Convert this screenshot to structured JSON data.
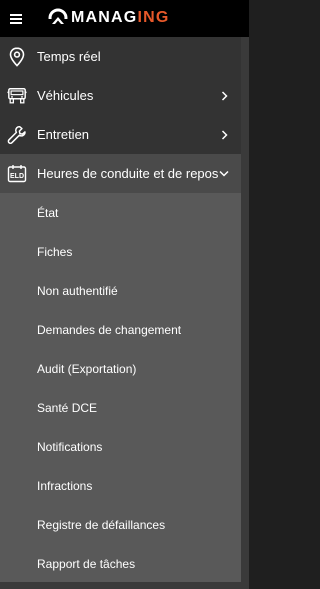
{
  "header": {
    "logo_text_main": "MANAG",
    "logo_text_accent": "ING",
    "menu_icon": "hamburger-icon",
    "logo_icon": "managing-logo-icon",
    "accent_color": "#e8592a"
  },
  "menu": {
    "items": [
      {
        "label": "Temps réel",
        "icon": "map-pin-icon",
        "has_chevron": false
      },
      {
        "label": "Véhicules",
        "icon": "truck-icon",
        "has_chevron": true,
        "chevron": "chevron-right-icon"
      },
      {
        "label": "Entretien",
        "icon": "wrench-icon",
        "has_chevron": true,
        "chevron": "chevron-right-icon"
      },
      {
        "label": "Heures de conduite et de repos",
        "icon": "eld-icon",
        "has_chevron": true,
        "chevron": "chevron-down-icon",
        "expanded": true
      }
    ]
  },
  "submenu": {
    "items": [
      {
        "label": "État"
      },
      {
        "label": "Fiches"
      },
      {
        "label": "Non authentifié"
      },
      {
        "label": "Demandes de changement"
      },
      {
        "label": "Audit (Exportation)"
      },
      {
        "label": "Santé DCE"
      },
      {
        "label": "Notifications"
      },
      {
        "label": "Infractions"
      },
      {
        "label": "Registre de défaillances"
      },
      {
        "label": "Rapport de tâches"
      }
    ]
  },
  "colors": {
    "header_bg": "#000000",
    "menu_bg": "#333333",
    "active_bg": "#4a4a4a",
    "submenu_bg": "#595959"
  }
}
